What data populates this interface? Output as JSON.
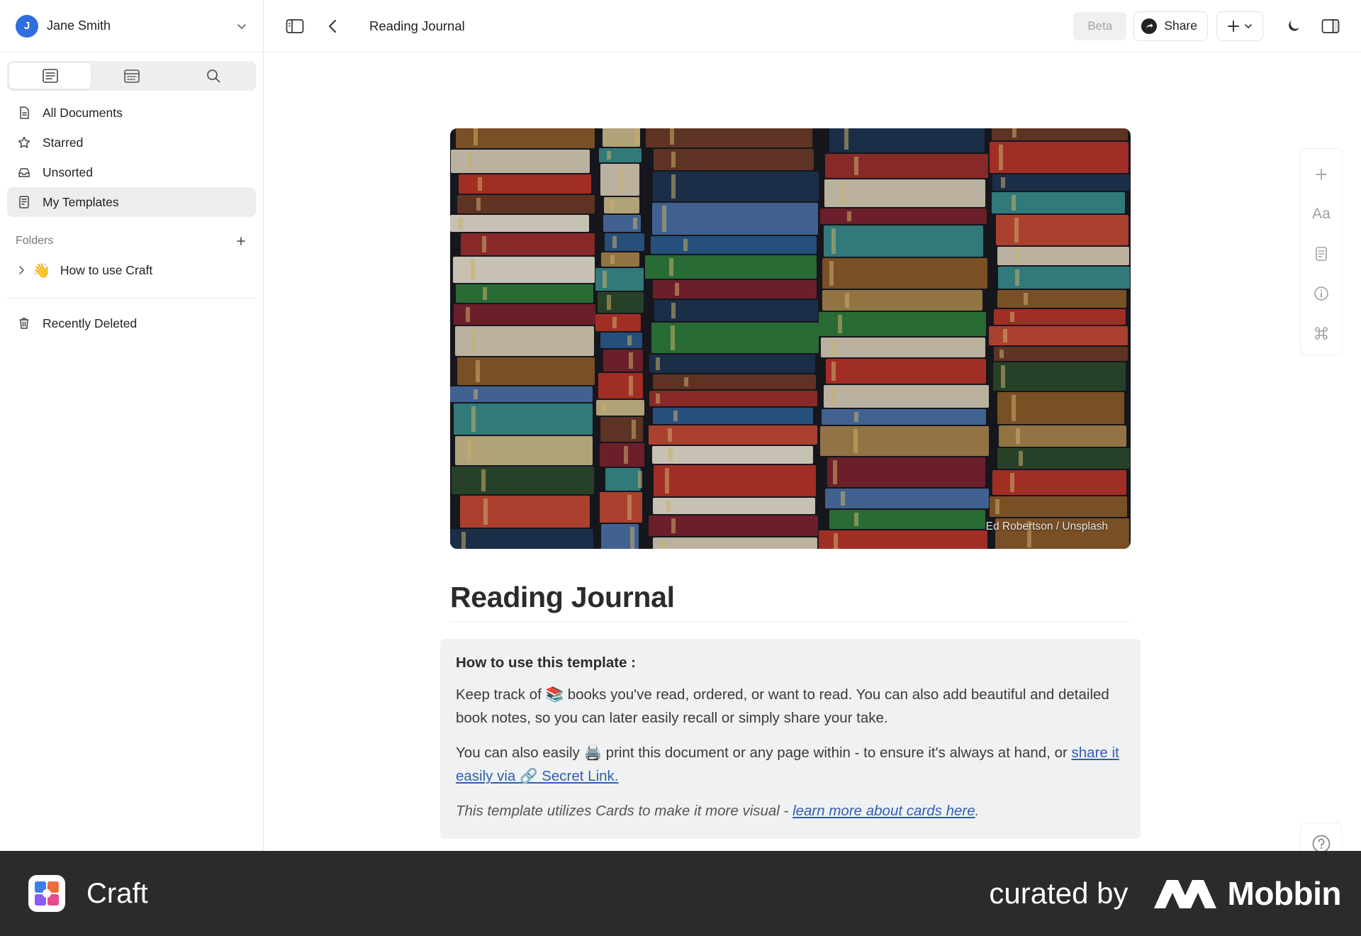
{
  "user": {
    "initial": "J",
    "name": "Jane Smith"
  },
  "sidebar": {
    "tabs": [
      "documents",
      "calendar",
      "search"
    ],
    "nav": [
      {
        "label": "All Documents",
        "icon": "document-icon"
      },
      {
        "label": "Starred",
        "icon": "star-icon"
      },
      {
        "label": "Unsorted",
        "icon": "tray-icon"
      },
      {
        "label": "My Templates",
        "icon": "template-icon",
        "selected": true
      }
    ],
    "folders_label": "Folders",
    "folders": [
      {
        "emoji": "👋",
        "label": "How to use Craft"
      }
    ],
    "recently_deleted": "Recently Deleted"
  },
  "topbar": {
    "title": "Reading Journal",
    "beta": "Beta",
    "share": "Share"
  },
  "document": {
    "cover_credit": "Ed Robertson / Unsplash",
    "title": "Reading Journal",
    "card": {
      "heading": "How to use this template :",
      "p1": "Keep track of 📚 books you've read, ordered, or want to read. You can also add beautiful and detailed book notes, so you can later easily recall or simply share your take.",
      "p2_prefix": "You can also easily 🖨️ print this document or any page within - to ensure it's always at hand, or ",
      "p2_link": "share it easily via 🔗 Secret Link.",
      "p3_prefix": "This template utilizes Cards to make it more visual - ",
      "p3_link": "learn more about cards here",
      "p3_suffix": "."
    }
  },
  "rail": {
    "text_style": "Aa"
  },
  "footer": {
    "app_name": "Craft",
    "curated": "curated by",
    "brand": "Mobbin"
  },
  "colors": {
    "accent": "#2f6ee0",
    "link": "#2f5fb3",
    "footer_bg": "#2b2b2b"
  }
}
